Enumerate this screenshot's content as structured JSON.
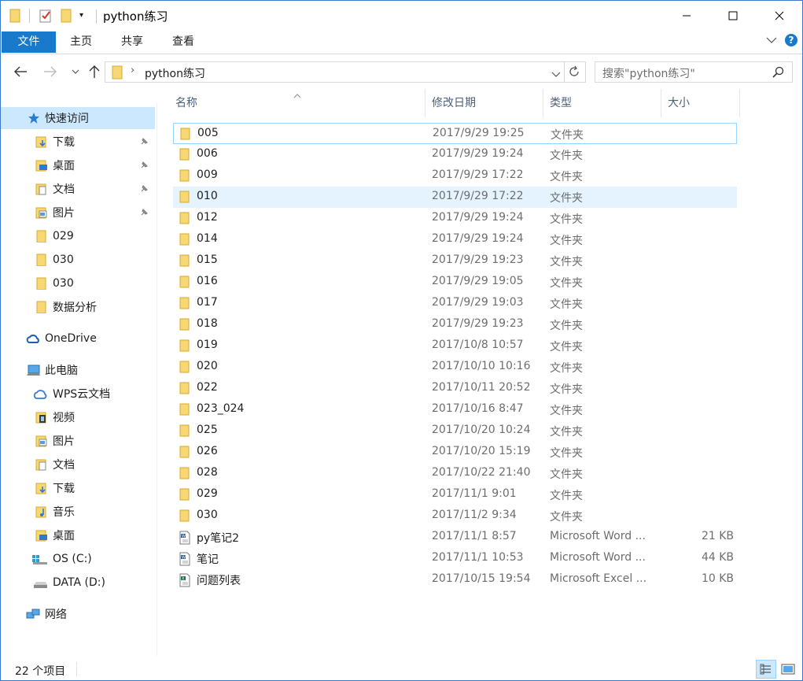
{
  "window": {
    "title": "python练习"
  },
  "ribbon": {
    "tabs": [
      "文件",
      "主页",
      "共享",
      "查看"
    ]
  },
  "address": {
    "path": "python练习",
    "search_placeholder": "搜索\"python练习\""
  },
  "nav": {
    "quick_access": "快速访问",
    "quick_items": [
      "下载",
      "桌面",
      "文档",
      "图片",
      "029",
      "030",
      "030",
      "数据分析"
    ],
    "onedrive": "OneDrive",
    "this_pc": "此电脑",
    "pc_items": [
      "WPS云文档",
      "视频",
      "图片",
      "文档",
      "下载",
      "音乐",
      "桌面",
      "OS (C:)",
      "DATA (D:)"
    ],
    "network": "网络"
  },
  "columns": {
    "name": "名称",
    "date": "修改日期",
    "type": "类型",
    "size": "大小"
  },
  "files": [
    {
      "name": "005",
      "date": "2017/9/29 19:25",
      "type": "文件夹",
      "size": "",
      "kind": "folder"
    },
    {
      "name": "006",
      "date": "2017/9/29 19:24",
      "type": "文件夹",
      "size": "",
      "kind": "folder"
    },
    {
      "name": "009",
      "date": "2017/9/29 17:22",
      "type": "文件夹",
      "size": "",
      "kind": "folder"
    },
    {
      "name": "010",
      "date": "2017/9/29 17:22",
      "type": "文件夹",
      "size": "",
      "kind": "folder"
    },
    {
      "name": "012",
      "date": "2017/9/29 19:24",
      "type": "文件夹",
      "size": "",
      "kind": "folder"
    },
    {
      "name": "014",
      "date": "2017/9/29 19:24",
      "type": "文件夹",
      "size": "",
      "kind": "folder"
    },
    {
      "name": "015",
      "date": "2017/9/29 19:23",
      "type": "文件夹",
      "size": "",
      "kind": "folder"
    },
    {
      "name": "016",
      "date": "2017/9/29 19:05",
      "type": "文件夹",
      "size": "",
      "kind": "folder"
    },
    {
      "name": "017",
      "date": "2017/9/29 19:03",
      "type": "文件夹",
      "size": "",
      "kind": "folder"
    },
    {
      "name": "018",
      "date": "2017/9/29 19:23",
      "type": "文件夹",
      "size": "",
      "kind": "folder"
    },
    {
      "name": "019",
      "date": "2017/10/8 10:57",
      "type": "文件夹",
      "size": "",
      "kind": "folder"
    },
    {
      "name": "020",
      "date": "2017/10/10 10:16",
      "type": "文件夹",
      "size": "",
      "kind": "folder"
    },
    {
      "name": "022",
      "date": "2017/10/11 20:52",
      "type": "文件夹",
      "size": "",
      "kind": "folder"
    },
    {
      "name": "023_024",
      "date": "2017/10/16 8:47",
      "type": "文件夹",
      "size": "",
      "kind": "folder"
    },
    {
      "name": "025",
      "date": "2017/10/20 10:24",
      "type": "文件夹",
      "size": "",
      "kind": "folder"
    },
    {
      "name": "026",
      "date": "2017/10/20 15:19",
      "type": "文件夹",
      "size": "",
      "kind": "folder"
    },
    {
      "name": "028",
      "date": "2017/10/22 21:40",
      "type": "文件夹",
      "size": "",
      "kind": "folder"
    },
    {
      "name": "029",
      "date": "2017/11/1 9:01",
      "type": "文件夹",
      "size": "",
      "kind": "folder"
    },
    {
      "name": "030",
      "date": "2017/11/2 9:34",
      "type": "文件夹",
      "size": "",
      "kind": "folder"
    },
    {
      "name": "py笔记2",
      "date": "2017/11/1 8:57",
      "type": "Microsoft Word ...",
      "size": "21 KB",
      "kind": "word"
    },
    {
      "name": "笔记",
      "date": "2017/11/1 10:53",
      "type": "Microsoft Word ...",
      "size": "44 KB",
      "kind": "word"
    },
    {
      "name": "问题列表",
      "date": "2017/10/15 19:54",
      "type": "Microsoft Excel ...",
      "size": "10 KB",
      "kind": "excel"
    }
  ],
  "status": {
    "count": "22 个项目"
  },
  "colors": {
    "accent": "#1979ca",
    "selected": "#cce8ff",
    "hover": "#e5f3ff",
    "folder": "#f8d775"
  }
}
